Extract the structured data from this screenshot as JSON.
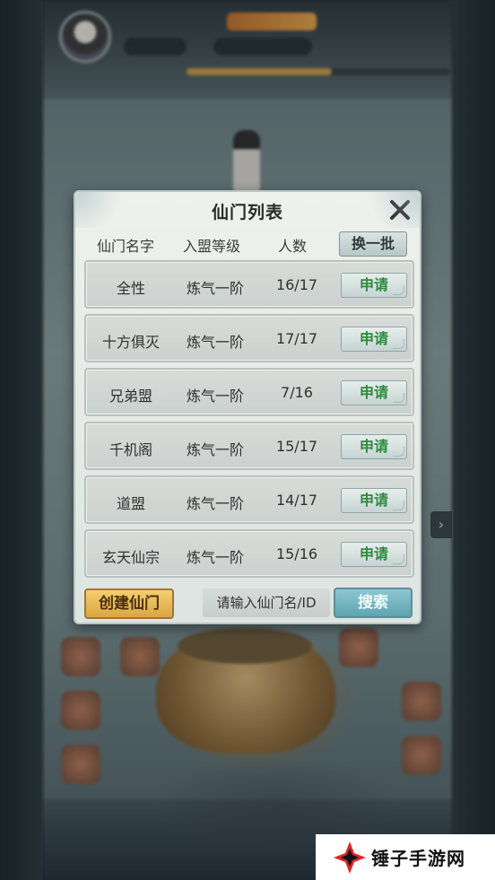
{
  "dialog": {
    "title": "仙门列表",
    "headers": {
      "name": "仙门名字",
      "level": "入盟等级",
      "count": "人数"
    },
    "refresh_label": "换一批",
    "apply_label": "申请",
    "rows": [
      {
        "name": "全性",
        "level": "炼气一阶",
        "count": "16/17"
      },
      {
        "name": "十方俱灭",
        "level": "炼气一阶",
        "count": "17/17"
      },
      {
        "name": "兄弟盟",
        "level": "炼气一阶",
        "count": "7/16"
      },
      {
        "name": "千机阁",
        "level": "炼气一阶",
        "count": "15/17"
      },
      {
        "name": "道盟",
        "level": "炼气一阶",
        "count": "14/17"
      },
      {
        "name": "玄天仙宗",
        "level": "炼气一阶",
        "count": "15/16"
      }
    ],
    "create_label": "创建仙门",
    "search_placeholder": "请输入仙门名/ID",
    "search_label": "搜索"
  },
  "watermark": {
    "text": "锤子手游网"
  },
  "colors": {
    "apply_text": "#2c8a3c",
    "create_bg": "#e8b955",
    "search_bg": "#74b6c0",
    "dialog_bg": "#e6ebe8"
  }
}
